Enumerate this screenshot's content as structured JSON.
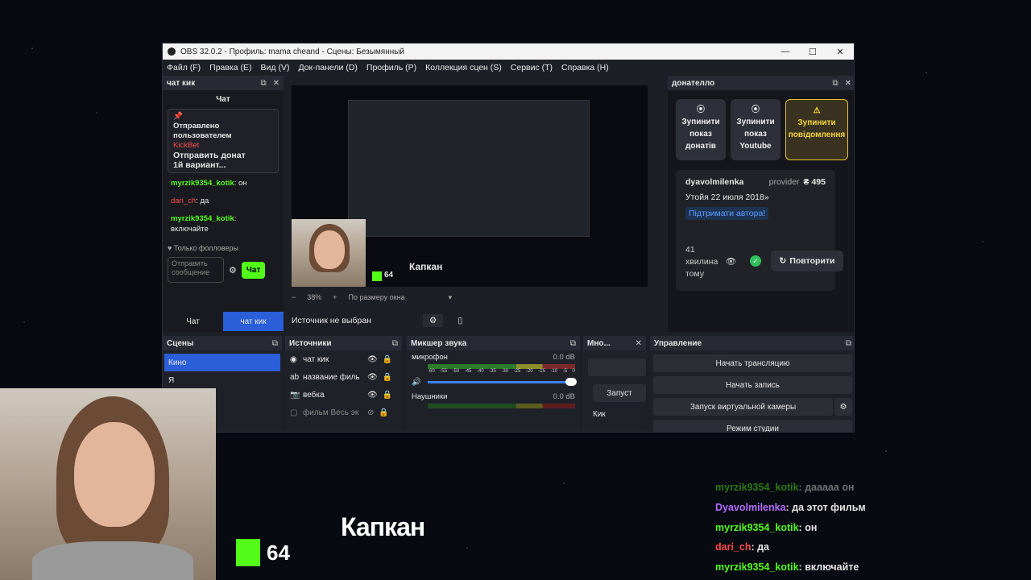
{
  "window": {
    "title": "OBS 32.0.2 - Профиль: mama cheand - Сцены: Безымянный"
  },
  "menu": [
    "Файл (F)",
    "Правка (E)",
    "Вид (V)",
    "Док-панели (D)",
    "Профиль (P)",
    "Коллекция сцен (S)",
    "Сервис (T)",
    "Справка (H)"
  ],
  "chat_dock": {
    "title": "чат кик",
    "header": "Чат",
    "pinned": {
      "line1": "Отправлено",
      "line2": "пользователем",
      "user": "KickBet",
      "text1": "Отправить донат",
      "text2": "1й вариант..."
    },
    "messages": [
      {
        "user": "myrzik9354_kotik",
        "text": ": он"
      },
      {
        "user": "dari_ch",
        "text": ": да"
      },
      {
        "user": "myrzik9354_kotik",
        "text": ":"
      },
      {
        "user": "",
        "text": "включайте"
      }
    ],
    "followers_only": "Только фолловеры",
    "input_placeholder": "Отправить сообщение",
    "send_label": "Чат",
    "tabs": [
      "Чат",
      "чат кик"
    ]
  },
  "preview": {
    "zoom": "38%",
    "fit": "По размеру окна",
    "overlay_title": "Капкан",
    "kick_count": "64",
    "no_source": "Источник не выбран"
  },
  "donate_dock": {
    "title": "донателло",
    "buttons": [
      {
        "l1": "Зупинити",
        "l2": "показ",
        "l3": "донатів"
      },
      {
        "l1": "Зупинити",
        "l2": "показ",
        "l3": "Youtube"
      },
      {
        "l1": "Зупинити",
        "l2": "повідомлення",
        "l3": ""
      }
    ],
    "card": {
      "user": "dyavolmilenka",
      "provider": "provider",
      "amount": "₴ 495",
      "message": "Утойя 22 июля 2018»",
      "support": "Підтримати автора!",
      "time1": "41",
      "time2": "хвилина",
      "time3": "тому",
      "repeat": "Повторити"
    }
  },
  "scenes": {
    "title": "Сцены",
    "items": [
      "Кино",
      "Я"
    ]
  },
  "sources": {
    "title": "Источники",
    "items": [
      "чат кик",
      "название филь",
      "вебка",
      "фильм Весь эк"
    ]
  },
  "mixer": {
    "title": "Микшер звука",
    "tracks": [
      {
        "name": "микрофон",
        "db": "0.0 dB"
      },
      {
        "name": "Наушники",
        "db": "0.0 dB"
      }
    ],
    "scale": [
      "-60",
      "-55",
      "-50",
      "-45",
      "-40",
      "-35",
      "-30",
      "-25",
      "-20",
      "-15",
      "-10",
      "-5",
      "0"
    ]
  },
  "multi": {
    "title": "Мно...",
    "start": "Запуст",
    "kick": "Кик"
  },
  "controls": {
    "title": "Управление",
    "stream": "Начать трансляцию",
    "record": "Начать запись",
    "vcam": "Запуск виртуальной камеры",
    "studio": "Режим студии"
  },
  "overlay": {
    "kick_count": "64",
    "title": "Капкан",
    "chat": [
      {
        "user": "myrzik9354_kotik",
        "text": "дааааа он",
        "color": "#53fc18"
      },
      {
        "user": "Dyavolmilenka",
        "text": "да этот фильм",
        "color": "#b46cff"
      },
      {
        "user": "myrzik9354_kotik",
        "text": "он",
        "color": "#53fc18"
      },
      {
        "user": "dari_ch",
        "text": "да",
        "color": "#ff4b4b"
      },
      {
        "user": "myrzik9354_kotik",
        "text": "включайте",
        "color": "#53fc18"
      }
    ]
  }
}
